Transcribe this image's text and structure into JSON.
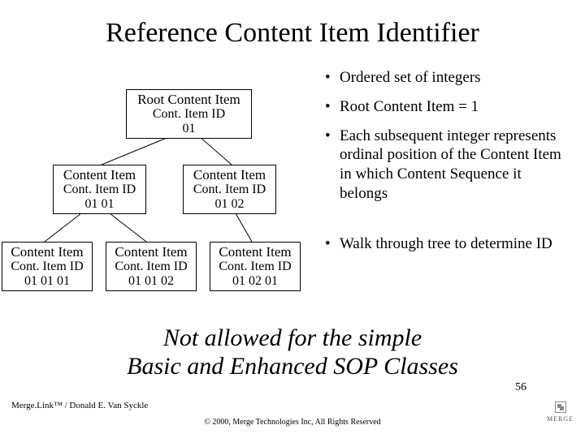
{
  "title": "Reference Content Item Identifier",
  "bullets": [
    "Ordered set of integers",
    "Root Content Item = 1",
    "Each subsequent integer represents ordinal position of the Content Item in which Content Sequence it belongs",
    "Walk through tree to determine ID"
  ],
  "tree": {
    "root": {
      "l1": "Root Content Item",
      "l2": "Cont. Item ID",
      "l3": "01"
    },
    "n11": {
      "l1": "Content Item",
      "l2": "Cont. Item ID",
      "l3": "01 01"
    },
    "n12": {
      "l1": "Content Item",
      "l2": "Cont. Item ID",
      "l3": "01 02"
    },
    "n111": {
      "l1": "Content Item",
      "l2": "Cont. Item ID",
      "l3": "01 01 01"
    },
    "n112": {
      "l1": "Content Item",
      "l2": "Cont. Item ID",
      "l3": "01 01 02"
    },
    "n121": {
      "l1": "Content Item",
      "l2": "Cont. Item ID",
      "l3": "01 02 01"
    }
  },
  "italic_note_line1": "Not allowed for the simple",
  "italic_note_line2": "Basic and Enhanced SOP Classes",
  "footer_left": "Merge.Link™ / Donald E. Van Syckle",
  "footer_center": "© 2000, Merge Technologies Inc, All Rights Reserved",
  "page_number": "56",
  "logo_text": "MERGE"
}
